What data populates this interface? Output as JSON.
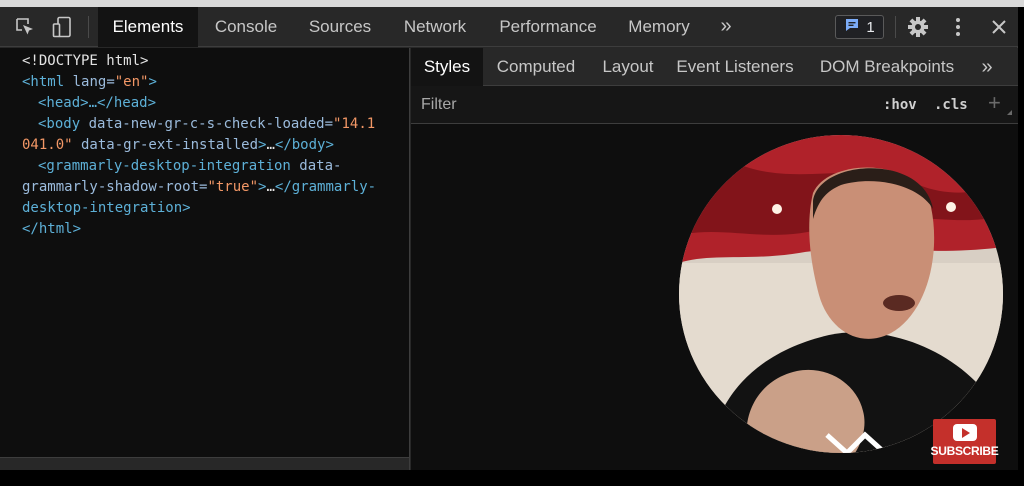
{
  "toolbar": {
    "tabs": [
      {
        "label": "Elements",
        "active": true
      },
      {
        "label": "Console",
        "active": false
      },
      {
        "label": "Sources",
        "active": false
      },
      {
        "label": "Network",
        "active": false
      },
      {
        "label": "Performance",
        "active": false
      },
      {
        "label": "Memory",
        "active": false
      }
    ],
    "more_tabs": "»",
    "issues_count": "1",
    "icons": [
      "inspect-element-icon",
      "device-toolbar-icon",
      "message-icon",
      "gear-icon",
      "kebab-menu-icon",
      "close-icon"
    ]
  },
  "dom": {
    "doctype": "<!DOCTYPE html>",
    "html_open": {
      "tag_open": "<html",
      "attr": " lang",
      "eq": "=",
      "value": "\"en\"",
      "close": ">"
    },
    "head": {
      "text": "<head>…</head>"
    },
    "body": {
      "tag_open": "<body",
      "attr1": " data-new-gr-c-s-check-loaded",
      "eq1": "=",
      "value1_part1": "\"14.1",
      "value1_part2": "041.0\"",
      "attr2": " data-gr-ext-installed",
      "close": ">",
      "ellipsis": "…",
      "end": "</body>"
    },
    "grammarly": {
      "tag_open": "<grammarly-desktop-integration",
      "attr_part1": " data-",
      "attr_part2": "grammarly-shadow-root",
      "eq": "=",
      "value": "\"true\"",
      "close": ">",
      "ellipsis": "…",
      "end_part1": "</grammarly-",
      "end_part2": "desktop-integration>"
    },
    "html_close": "</html>"
  },
  "styles_pane": {
    "tabs": [
      {
        "label": "Styles",
        "active": true
      },
      {
        "label": "Computed",
        "active": false
      },
      {
        "label": "Layout",
        "active": false
      },
      {
        "label": "Event Listeners",
        "active": false
      },
      {
        "label": "DOM Breakpoints",
        "active": false
      }
    ],
    "more_tabs": "»",
    "filter_placeholder": "Filter",
    "hov_label": ":hov",
    "cls_label": ".cls",
    "new_rule": "+"
  },
  "overlay": {
    "subscribe_label": "SUBSCRIBE"
  },
  "colors": {
    "background": "#282828",
    "panel": "#0e0e0e",
    "tag": "#5db0d7",
    "attribute": "#9bbbdc",
    "string": "#f29766",
    "subscribe": "#c4302b"
  }
}
